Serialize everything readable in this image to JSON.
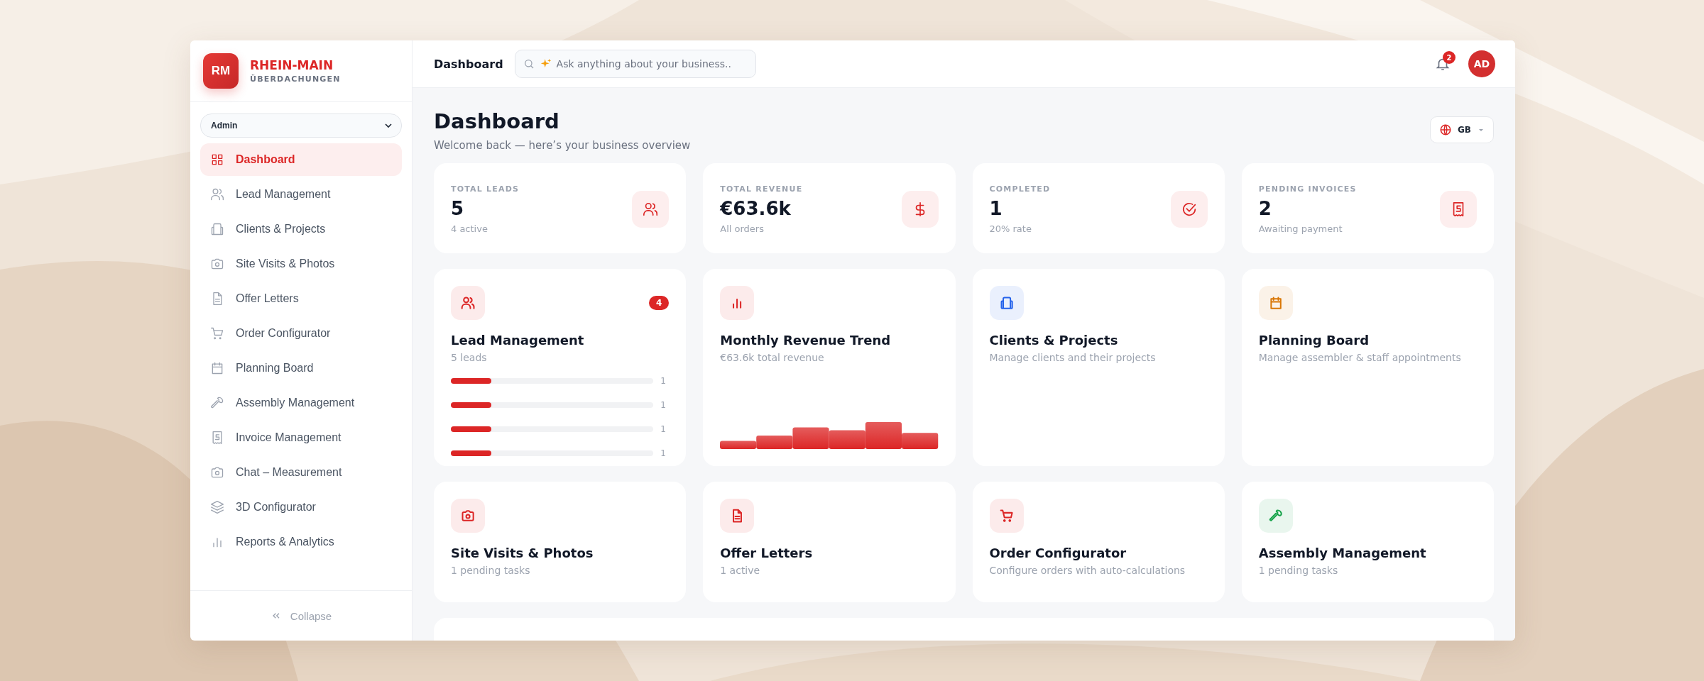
{
  "sidebar": {
    "logo": {
      "initials": "RM",
      "name": "RHEIN-MAIN",
      "subtitle": "ÜBERDACHUNGEN"
    },
    "role_select": {
      "value": "Admin"
    },
    "items": [
      {
        "label": "Dashboard",
        "selected": true
      },
      {
        "label": "Lead Management",
        "selected": false
      },
      {
        "label": "Clients & Projects",
        "selected": false
      },
      {
        "label": "Site Visits & Photos",
        "selected": false
      },
      {
        "label": "Offer Letters",
        "selected": false
      },
      {
        "label": "Order Configurator",
        "selected": false
      },
      {
        "label": "Planning Board",
        "selected": false
      },
      {
        "label": "Assembly Management",
        "selected": false
      },
      {
        "label": "Invoice Management",
        "selected": false
      },
      {
        "label": "Chat – Measurement",
        "selected": false
      },
      {
        "label": "3D Configurator",
        "selected": false
      },
      {
        "label": "Reports & Analytics",
        "selected": false
      }
    ],
    "collapse": "Collapse"
  },
  "header": {
    "title": "Dashboard",
    "search": {
      "placeholder": "Ask anything about your business.."
    },
    "notifications": "2",
    "avatar": "AD"
  },
  "page": {
    "title": "Dashboard",
    "subtitle": "Welcome back — here’s your business overview",
    "language": "GB"
  },
  "stats": [
    {
      "label": "TOTAL LEADS",
      "value": "5",
      "note": "4 active"
    },
    {
      "label": "TOTAL REVENUE",
      "value": "€63.6k",
      "note": "All orders"
    },
    {
      "label": "COMPLETED",
      "value": "1",
      "note": "20% rate"
    },
    {
      "label": "PENDING INVOICES",
      "value": "2",
      "note": "Awaiting payment"
    }
  ],
  "modules": [
    {
      "kind": "bars",
      "title": "Lead Management",
      "subtitle": "5 leads",
      "color": "#dc2626",
      "badge": "4",
      "bars": [
        {
          "level": 0.2,
          "reading": "1"
        },
        {
          "level": 0.2,
          "reading": "1"
        },
        {
          "level": 0.2,
          "reading": "1"
        },
        {
          "level": 0.2,
          "reading": "1"
        }
      ]
    },
    {
      "kind": "sparkline",
      "title": "Monthly Revenue Trend",
      "subtitle": "€63.6k total revenue",
      "color": "#dc2626"
    },
    {
      "kind": "plain",
      "title": "Clients & Projects",
      "subtitle": "Manage clients and their projects",
      "color": "#2563eb"
    },
    {
      "kind": "plain",
      "title": "Planning Board",
      "subtitle": "Manage assembler & staff appointments",
      "color": "#d97706"
    },
    {
      "kind": "plain",
      "title": "Site Visits & Photos",
      "subtitle": "1 pending tasks",
      "color": "#dc2626"
    },
    {
      "kind": "plain",
      "title": "Offer Letters",
      "subtitle": "1 active",
      "color": "#dc2626"
    },
    {
      "kind": "plain",
      "title": "Order Configurator",
      "subtitle": "Configure orders with auto-calculations",
      "color": "#dc2626"
    },
    {
      "kind": "plain",
      "title": "Assembly Management",
      "subtitle": "1 pending tasks",
      "color": "#16a34a"
    }
  ]
}
